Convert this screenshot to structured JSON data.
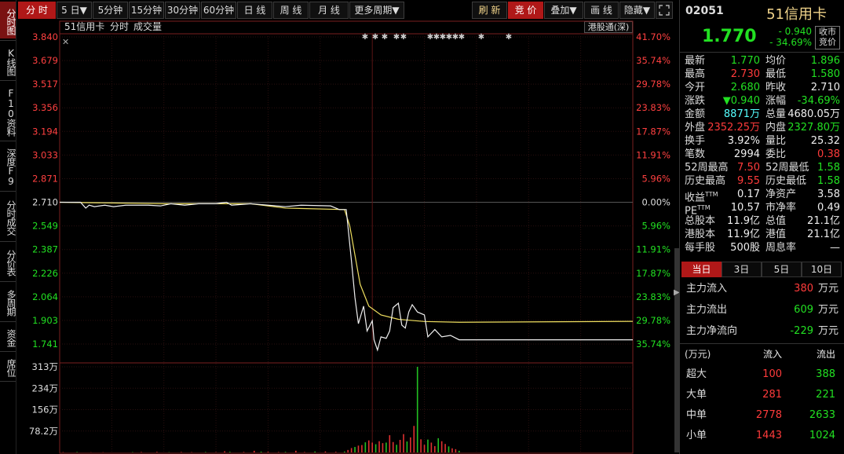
{
  "left_tabs": [
    {
      "label": "分时图",
      "active": true
    },
    {
      "label": "K线图",
      "active": false
    },
    {
      "label": "F10资料",
      "active": false
    },
    {
      "label": "深度F9",
      "active": false
    },
    {
      "label": "分时成交",
      "active": false
    },
    {
      "label": "分价表",
      "active": false
    },
    {
      "label": "多周期",
      "active": false
    },
    {
      "label": "资金",
      "active": false
    },
    {
      "label": "席位",
      "active": false
    }
  ],
  "toolbar": {
    "periods": [
      "分 时",
      "5 日▼",
      "5分钟",
      "15分钟",
      "30分钟",
      "60分钟",
      "日 线",
      "周 线",
      "月 线",
      "更多周期▼"
    ],
    "refresh": "刷 新",
    "auction": "竞 价",
    "overlay": "叠加▼",
    "draw": "画 线",
    "hide": "隐藏▼",
    "fullscreen_icon": "expand-icon"
  },
  "chart_header": {
    "name": "51信用卡",
    "mode": "分时",
    "vol_label": "成交量",
    "hk_link": "港股通(深)"
  },
  "chart_data": {
    "type": "line",
    "prev_close": 2.71,
    "price_ticks": [
      "3.840",
      "3.679",
      "3.517",
      "3.356",
      "3.194",
      "3.033",
      "2.871",
      "2.710",
      "2.549",
      "2.387",
      "2.226",
      "2.064",
      "1.903",
      "1.741"
    ],
    "pct_ticks": [
      "41.70%",
      "35.74%",
      "29.78%",
      "23.83%",
      "17.87%",
      "11.91%",
      "5.96%",
      "0.00%",
      "5.96%",
      "11.91%",
      "17.87%",
      "23.83%",
      "29.78%",
      "35.74%"
    ],
    "vol_ticks": [
      "313万",
      "234万",
      "156万",
      "78.2万"
    ],
    "ylim": [
      1.741,
      3.84
    ],
    "total_minutes": 330,
    "price_series": [
      [
        0,
        2.71
      ],
      [
        12,
        2.71
      ],
      [
        15,
        2.67
      ],
      [
        17,
        2.69
      ],
      [
        20,
        2.68
      ],
      [
        26,
        2.69
      ],
      [
        31,
        2.68
      ],
      [
        38,
        2.69
      ],
      [
        51,
        2.69
      ],
      [
        58,
        2.685
      ],
      [
        64,
        2.7
      ],
      [
        72,
        2.69
      ],
      [
        80,
        2.7
      ],
      [
        90,
        2.7
      ],
      [
        96,
        2.71
      ],
      [
        99,
        2.69
      ],
      [
        110,
        2.7
      ],
      [
        120,
        2.69
      ],
      [
        130,
        2.68
      ],
      [
        139,
        2.69
      ],
      [
        156,
        2.685
      ],
      [
        161,
        2.66
      ],
      [
        165,
        2.66
      ],
      [
        168,
        2.31
      ],
      [
        170,
        2.06
      ],
      [
        172,
        1.88
      ],
      [
        175,
        2.0
      ],
      [
        177,
        1.83
      ],
      [
        180,
        1.9
      ],
      [
        181,
        1.77
      ],
      [
        183,
        1.7
      ],
      [
        185,
        1.79
      ],
      [
        188,
        1.78
      ],
      [
        190,
        1.83
      ],
      [
        192,
        1.99
      ],
      [
        195,
        2.02
      ],
      [
        197,
        1.87
      ],
      [
        199,
        1.85
      ],
      [
        201,
        1.96
      ],
      [
        203,
        2.01
      ],
      [
        206,
        1.96
      ],
      [
        210,
        1.94
      ],
      [
        212,
        1.79
      ],
      [
        216,
        1.84
      ],
      [
        220,
        1.79
      ],
      [
        225,
        1.8
      ],
      [
        230,
        1.77
      ],
      [
        250,
        1.77
      ],
      [
        330,
        1.77
      ]
    ],
    "avg_series": [
      [
        0,
        2.71
      ],
      [
        60,
        2.7
      ],
      [
        110,
        2.7
      ],
      [
        130,
        2.67
      ],
      [
        164,
        2.66
      ],
      [
        167,
        2.55
      ],
      [
        170,
        2.35
      ],
      [
        173,
        2.15
      ],
      [
        178,
        2.0
      ],
      [
        185,
        1.94
      ],
      [
        195,
        1.91
      ],
      [
        210,
        1.895
      ],
      [
        230,
        1.89
      ],
      [
        330,
        1.896
      ]
    ],
    "volume": [
      [
        2,
        1.2
      ],
      [
        10,
        1.5
      ],
      [
        18,
        0.6
      ],
      [
        25,
        0.8
      ],
      [
        42,
        1.2
      ],
      [
        47,
        1.6
      ],
      [
        56,
        2.0
      ],
      [
        63,
        0.9
      ],
      [
        70,
        1.7
      ],
      [
        76,
        1.1
      ],
      [
        84,
        1.6
      ],
      [
        90,
        1.0
      ],
      [
        95,
        4.2
      ],
      [
        98,
        2.4
      ],
      [
        106,
        1.8
      ],
      [
        112,
        6.0
      ],
      [
        116,
        3.0
      ],
      [
        120,
        2.5
      ],
      [
        126,
        1.5
      ],
      [
        130,
        2.0
      ],
      [
        136,
        6.2
      ],
      [
        141,
        1.5
      ],
      [
        147,
        3.4
      ],
      [
        153,
        3.6
      ],
      [
        159,
        2.2
      ],
      [
        164,
        3.3
      ],
      [
        166,
        9.0
      ],
      [
        168,
        16.0
      ],
      [
        170,
        20.0
      ],
      [
        172,
        25.0
      ],
      [
        174,
        27.0
      ],
      [
        176,
        37.0
      ],
      [
        178,
        44.0
      ],
      [
        180,
        36.0
      ],
      [
        182,
        30.0
      ],
      [
        184,
        41.0
      ],
      [
        186,
        34.0
      ],
      [
        188,
        36.0
      ],
      [
        190,
        63.0
      ],
      [
        192,
        38.0
      ],
      [
        194,
        28.0
      ],
      [
        196,
        46.0
      ],
      [
        198,
        67.0
      ],
      [
        200,
        40.0
      ],
      [
        202,
        55.0
      ],
      [
        204,
        97.0
      ],
      [
        206,
        313.0
      ],
      [
        208,
        48.0
      ],
      [
        210,
        28.0
      ],
      [
        212,
        47.0
      ],
      [
        214,
        36.0
      ],
      [
        216,
        23.0
      ],
      [
        218,
        52.0
      ],
      [
        220,
        41.0
      ],
      [
        222,
        31.0
      ],
      [
        224,
        22.0
      ],
      [
        226,
        15.0
      ],
      [
        228,
        12.0
      ],
      [
        230,
        6.0
      ]
    ],
    "volume_colors_note_up": "#e03030",
    "volume_colors_note_down": "#22c022"
  },
  "quote": {
    "code": "02051",
    "name": "51信用卡",
    "price": "1.770",
    "change": "- 0.940",
    "change_pct": "- 34.69%",
    "close_auction": "收市竞价",
    "rows": [
      {
        "l": "最新",
        "v": "1.770",
        "vc": "green",
        "l2": "均价",
        "v2": "1.896",
        "v2c": "green"
      },
      {
        "l": "最高",
        "v": "2.730",
        "vc": "red",
        "l2": "最低",
        "v2": "1.580",
        "v2c": "green"
      },
      {
        "l": "今开",
        "v": "2.680",
        "vc": "green",
        "l2": "昨收",
        "v2": "2.710",
        "v2c": "white"
      },
      {
        "l": "涨跌",
        "v": "▼0.940",
        "vc": "green",
        "l2": "涨幅",
        "v2": "-34.69%",
        "v2c": "green"
      },
      {
        "l": "金额",
        "v": "8871万",
        "vc": "cyan",
        "l2": "总量",
        "v2": "4680.05万",
        "v2c": "white"
      },
      {
        "l": "外盘",
        "v": "2352.25万",
        "vc": "red",
        "l2": "内盘",
        "v2": "2327.80万",
        "v2c": "green"
      },
      {
        "l": "换手",
        "v": "3.92%",
        "vc": "white",
        "l2": "量比",
        "v2": "25.32",
        "v2c": "white"
      },
      {
        "l": "笔数",
        "v": "2994",
        "vc": "white",
        "l2": "委比",
        "v2": "0.38",
        "v2c": "red"
      },
      {
        "l": "52周最高",
        "v": "7.50",
        "vc": "red",
        "l2": "52周最低",
        "v2": "1.58",
        "v2c": "green"
      },
      {
        "l": "历史最高",
        "v": "9.55",
        "vc": "red",
        "l2": "历史最低",
        "v2": "1.58",
        "v2c": "green"
      },
      {
        "l": "收益TTM",
        "v": "0.17",
        "vc": "white",
        "l2": "净资产",
        "v2": "3.58",
        "v2c": "white"
      },
      {
        "l": "PETTM",
        "v": "10.57",
        "vc": "white",
        "l2": "市净率",
        "v2": "0.49",
        "v2c": "white"
      },
      {
        "l": "总股本",
        "v": "11.9亿",
        "vc": "white",
        "l2": "总值",
        "v2": "21.1亿",
        "v2c": "white"
      },
      {
        "l": "港股本",
        "v": "11.9亿",
        "vc": "white",
        "l2": "港值",
        "v2": "21.1亿",
        "v2c": "white"
      },
      {
        "l": "每手股",
        "v": "500股",
        "vc": "white",
        "l2": "周息率",
        "v2": "—",
        "v2c": "white"
      }
    ]
  },
  "flow": {
    "tabs": [
      {
        "label": "当日",
        "active": true
      },
      {
        "label": "3日",
        "active": false
      },
      {
        "label": "5日",
        "active": false
      },
      {
        "label": "10日",
        "active": false
      }
    ],
    "rows": [
      {
        "l": "主力流入",
        "v": "380",
        "vc": "red",
        "u": "万元"
      },
      {
        "l": "主力流出",
        "v": "609",
        "vc": "green",
        "u": "万元"
      },
      {
        "l": "主力净流向",
        "v": "-229",
        "vc": "green",
        "u": "万元"
      }
    ],
    "table_header": {
      "unit": "(万元)",
      "in": "流入",
      "out": "流出"
    },
    "table": [
      {
        "l": "超大",
        "in": "100",
        "out": "388"
      },
      {
        "l": "大单",
        "in": "281",
        "out": "221"
      },
      {
        "l": "中单",
        "in": "2778",
        "out": "2633"
      },
      {
        "l": "小单",
        "in": "1443",
        "out": "1024"
      }
    ]
  }
}
